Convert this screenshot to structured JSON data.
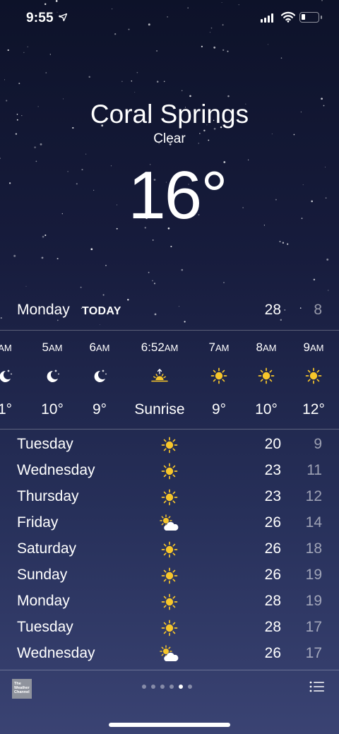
{
  "status_bar": {
    "time": "9:55",
    "icons": [
      "location-arrow-icon",
      "cellular-signal-icon",
      "wifi-icon",
      "battery-low-icon"
    ]
  },
  "location": {
    "city": "Coral Springs",
    "condition": "Clear",
    "temperature": "16°"
  },
  "today": {
    "day": "Monday",
    "tag": "TODAY",
    "high": "28",
    "low": "8"
  },
  "hourly": [
    {
      "time": "",
      "ampm": "AM",
      "icon": "moon-stars-icon",
      "temp": "1°"
    },
    {
      "time": "5",
      "ampm": "AM",
      "icon": "moon-stars-icon",
      "temp": "10°"
    },
    {
      "time": "6",
      "ampm": "AM",
      "icon": "moon-stars-icon",
      "temp": "9°"
    },
    {
      "time": "6:52",
      "ampm": "AM",
      "icon": "sunrise-icon",
      "temp": "Sunrise"
    },
    {
      "time": "7",
      "ampm": "AM",
      "icon": "sun-icon",
      "temp": "9°"
    },
    {
      "time": "8",
      "ampm": "AM",
      "icon": "sun-icon",
      "temp": "10°"
    },
    {
      "time": "9",
      "ampm": "AM",
      "icon": "sun-icon",
      "temp": "12°"
    }
  ],
  "daily": [
    {
      "day": "Tuesday",
      "icon": "sun-icon",
      "high": "20",
      "low": "9"
    },
    {
      "day": "Wednesday",
      "icon": "sun-icon",
      "high": "23",
      "low": "11"
    },
    {
      "day": "Thursday",
      "icon": "sun-icon",
      "high": "23",
      "low": "12"
    },
    {
      "day": "Friday",
      "icon": "partly-cloudy-icon",
      "high": "26",
      "low": "14"
    },
    {
      "day": "Saturday",
      "icon": "sun-icon",
      "high": "26",
      "low": "18"
    },
    {
      "day": "Sunday",
      "icon": "sun-icon",
      "high": "26",
      "low": "19"
    },
    {
      "day": "Monday",
      "icon": "sun-icon",
      "high": "28",
      "low": "19"
    },
    {
      "day": "Tuesday",
      "icon": "sun-icon",
      "high": "28",
      "low": "17"
    },
    {
      "day": "Wednesday",
      "icon": "partly-cloudy-icon",
      "high": "26",
      "low": "17"
    }
  ],
  "footer": {
    "logo_text": "The Weather Channel",
    "page_count": 6,
    "active_page": 5
  },
  "colors": {
    "sun": "#f7c62b",
    "background_top": "#0d1229",
    "background_bottom": "#3a4373"
  }
}
